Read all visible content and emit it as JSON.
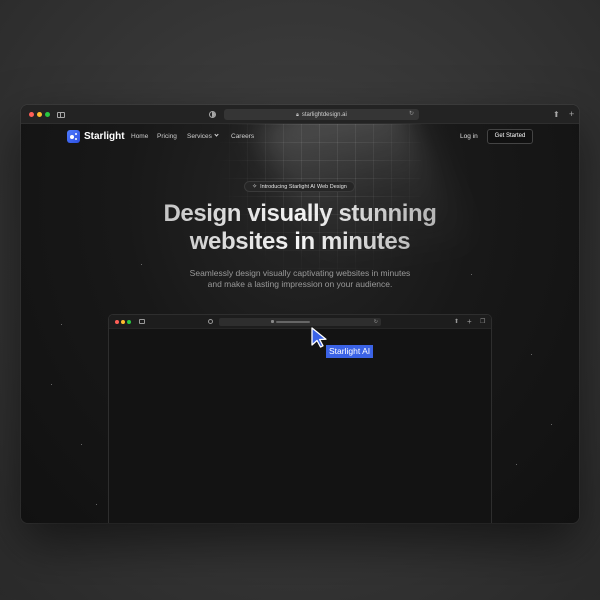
{
  "browser": {
    "url": "starlightdesign.ai",
    "lock_icon": "lock-icon",
    "reload_icon": "reload-icon"
  },
  "nav": {
    "logo_text": "Starlight",
    "links": [
      "Home",
      "Pricing",
      "Services",
      "Careers"
    ],
    "login": "Log in",
    "cta": "Get Started"
  },
  "hero": {
    "badge": "Introducing Starlight AI Web Design",
    "title_line1": "Design visually stunning",
    "title_line2": "websites in minutes",
    "subtitle_line1": "Seamlessly design visually captivating websites in minutes",
    "subtitle_line2": "and make a lasting impression on your audience."
  },
  "cursor": {
    "label": "Starlight AI"
  },
  "colors": {
    "accent": "#3b63e6",
    "background": "#141414"
  }
}
